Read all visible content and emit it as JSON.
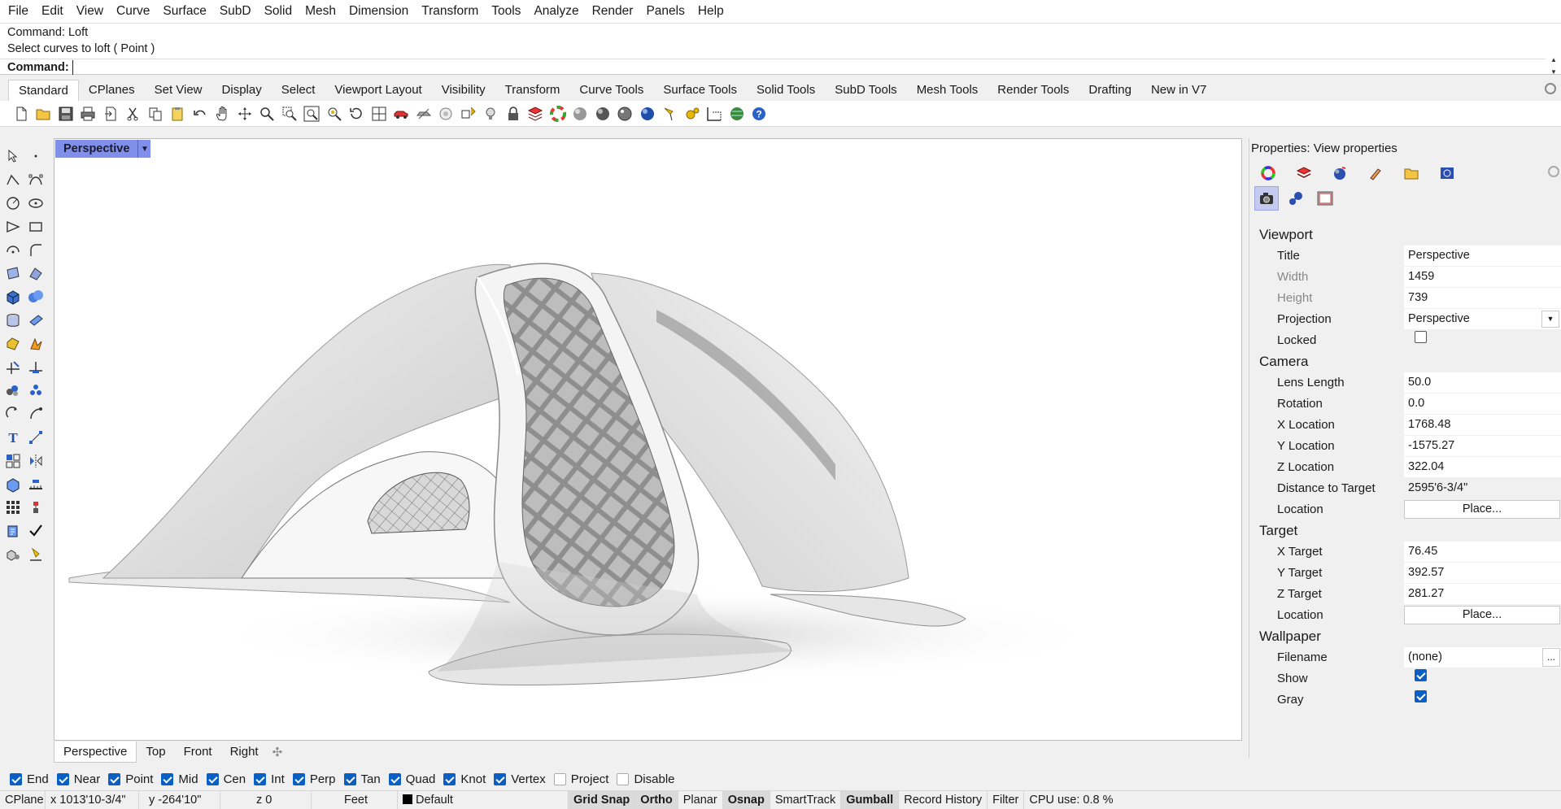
{
  "menu": [
    "File",
    "Edit",
    "View",
    "Curve",
    "Surface",
    "SubD",
    "Solid",
    "Mesh",
    "Dimension",
    "Transform",
    "Tools",
    "Analyze",
    "Render",
    "Panels",
    "Help"
  ],
  "command": {
    "history": [
      "Command: Loft",
      "Select curves to loft ( Point )"
    ],
    "prompt_label": "Command:",
    "input_value": ""
  },
  "toolbar_tabs": [
    "Standard",
    "CPlanes",
    "Set View",
    "Display",
    "Select",
    "Viewport Layout",
    "Visibility",
    "Transform",
    "Curve Tools",
    "Surface Tools",
    "Solid Tools",
    "SubD Tools",
    "Mesh Tools",
    "Render Tools",
    "Drafting",
    "New in V7"
  ],
  "toolbar_icons": [
    "new-icon",
    "open-icon",
    "save-icon",
    "print-icon",
    "import-icon",
    "cut-icon",
    "copy-icon",
    "paste-icon",
    "undo-icon",
    "pan-icon",
    "rotate-view-icon",
    "zoom-icon",
    "zoom-window-icon",
    "zoom-extents-icon",
    "zoom-selected-icon",
    "rotate-icon",
    "four-view-icon",
    "car-icon",
    "hide-icon",
    "show-icon",
    "points-icon",
    "light-icon",
    "lock-icon",
    "layer-icon",
    "color-wheel-icon",
    "shaded-sphere-icon",
    "rendered-sphere-icon",
    "render-sphere-icon",
    "render-blue-icon",
    "lamp-icon",
    "gear-options-icon",
    "snap-grid-icon",
    "globe-icon",
    "help-icon"
  ],
  "viewport": {
    "title": "Perspective",
    "tabs": [
      "Perspective",
      "Top",
      "Front",
      "Right"
    ]
  },
  "properties": {
    "title": "Properties: View properties",
    "sections": {
      "viewport": {
        "title": "Viewport",
        "title_label": "Title",
        "title_value": "Perspective",
        "width_label": "Width",
        "width_value": "1459",
        "height_label": "Height",
        "height_value": "739",
        "projection_label": "Projection",
        "projection_value": "Perspective",
        "locked_label": "Locked",
        "locked": false
      },
      "camera": {
        "title": "Camera",
        "lens_label": "Lens Length",
        "lens_value": "50.0",
        "rotation_label": "Rotation",
        "rotation_value": "0.0",
        "x_label": "X Location",
        "x_value": "1768.48",
        "y_label": "Y Location",
        "y_value": "-1575.27",
        "z_label": "Z Location",
        "z_value": "322.04",
        "dist_label": "Distance to Target",
        "dist_value": "2595'6-3/4\"",
        "location_label": "Location",
        "place_label": "Place..."
      },
      "target": {
        "title": "Target",
        "x_label": "X Target",
        "x_value": "76.45",
        "y_label": "Y Target",
        "y_value": "392.57",
        "z_label": "Z Target",
        "z_value": "281.27",
        "location_label": "Location",
        "place_label": "Place..."
      },
      "wallpaper": {
        "title": "Wallpaper",
        "filename_label": "Filename",
        "filename_value": "(none)",
        "browse_label": "...",
        "show_label": "Show",
        "show": true,
        "gray_label": "Gray",
        "gray": true
      }
    }
  },
  "osnaps": [
    {
      "label": "End",
      "on": true
    },
    {
      "label": "Near",
      "on": true
    },
    {
      "label": "Point",
      "on": true
    },
    {
      "label": "Mid",
      "on": true
    },
    {
      "label": "Cen",
      "on": true
    },
    {
      "label": "Int",
      "on": true
    },
    {
      "label": "Perp",
      "on": true
    },
    {
      "label": "Tan",
      "on": true
    },
    {
      "label": "Quad",
      "on": true
    },
    {
      "label": "Knot",
      "on": true
    },
    {
      "label": "Vertex",
      "on": true
    },
    {
      "label": "Project",
      "on": false
    },
    {
      "label": "Disable",
      "on": false
    }
  ],
  "status": {
    "cplane": "CPlane",
    "x": "x 1013'10-3/4\"",
    "y": "y -264'10\"",
    "z": "z 0",
    "units": "Feet",
    "layer": "Default",
    "grid_snap": "Grid Snap",
    "ortho": "Ortho",
    "planar": "Planar",
    "osnap": "Osnap",
    "smarttrack": "SmartTrack",
    "gumball": "Gumball",
    "record_history": "Record History",
    "filter": "Filter",
    "cpu": "CPU use: 0.8 %"
  }
}
